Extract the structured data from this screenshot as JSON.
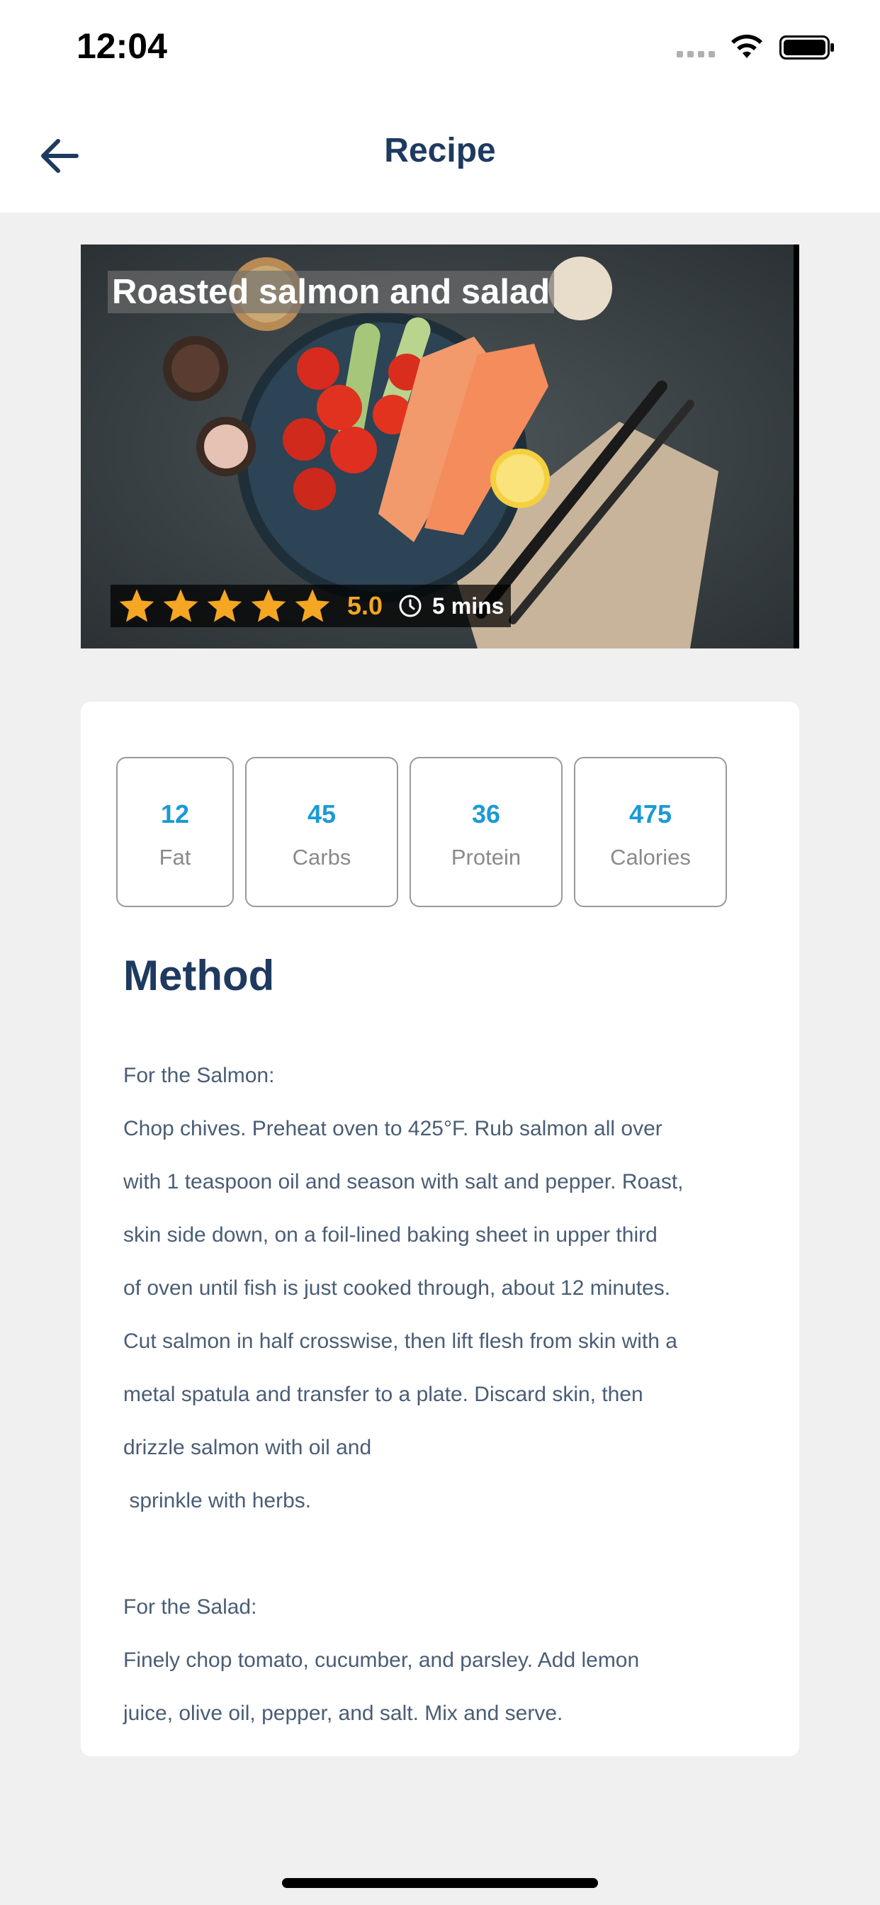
{
  "status_bar": {
    "time": "12:04"
  },
  "nav": {
    "title": "Recipe"
  },
  "hero": {
    "title": "Roasted salmon and salad",
    "rating": "5.0",
    "stars": 5,
    "time": "5 mins"
  },
  "nutrients": [
    {
      "value": "12",
      "label": "Fat"
    },
    {
      "value": "45",
      "label": "Carbs"
    },
    {
      "value": "36",
      "label": "Protein"
    },
    {
      "value": "475",
      "label": "Calories"
    }
  ],
  "method": {
    "title": "Method",
    "lines": [
      "For the Salmon:",
      "Chop chives. Preheat oven to 425°F. Rub salmon all over",
      "with 1 teaspoon oil and season with salt and pepper. Roast,",
      "skin side down, on a foil-lined baking sheet in upper third",
      "of oven until fish is just cooked through, about 12 minutes.",
      "Cut salmon in half crosswise, then lift flesh from skin with a",
      "metal spatula and transfer to a plate. Discard skin, then",
      "drizzle salmon with oil and",
      " sprinkle with herbs.",
      "",
      "For the Salad:",
      "Finely chop tomato, cucumber, and parsley. Add lemon",
      "juice, olive oil, pepper, and salt. Mix and serve."
    ]
  },
  "colors": {
    "accent": "#1a9ad6",
    "title": "#1e3a5f",
    "star": "#f5a623"
  }
}
